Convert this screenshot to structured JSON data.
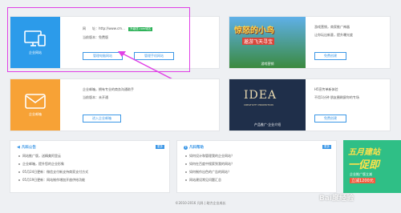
{
  "cards": {
    "website": {
      "tile_label": "企业网站",
      "url_label": "网　　址：http://www.cm...",
      "tag": "升级送.com域名",
      "version_label": "当前版本：免费版",
      "btn_manage_pc": "管理电脑网站",
      "btn_manage_mobile": "管理手机网站"
    },
    "game": {
      "banner_line1": "惊怒的小鸟",
      "banner_line2": "遨游飞天寻宝",
      "banner_caption": "游戏营销",
      "desc_line1": "游戏营销，商家推广神器",
      "desc_line2": "让你玩出新意，提升曝光度",
      "btn": "免费创建"
    },
    "mail": {
      "tile_label": "企业邮箱",
      "desc_line1": "企业邮箱，拥有专业的商务沟通助手",
      "version_label": "当前版本：未开通",
      "btn": "进入企业邮箱"
    },
    "h5": {
      "banner_title": "IDEA",
      "banner_sub": "CREATIVITY PROMOTION",
      "banner_caption": "产品推广·企业介绍",
      "desc_line1": "H5宣传单新体验",
      "desc_line2": "不用1分钟 朋友圈刷屏你的专场",
      "btn": "免费创建"
    }
  },
  "notice": {
    "title": "凡科公告",
    "more": "更多",
    "items": [
      "网站推广版，送精美阿里云",
      "企业邮箱，提升您的企业形象",
      "05月24日更新：微信支付新支持商家支付方式",
      "05月19日更新：网站制作增加开放供给功能"
    ]
  },
  "help": {
    "title": "凡科帮助",
    "more": "更多",
    "items": [
      "如何设计和管理我的企业网站？",
      "如何在百度中搜索到我的网站？",
      "如何制作出色的广告的网站？",
      "网站建设常见问题汇总"
    ]
  },
  "promo": {
    "line1": "五月建站",
    "line2": "一促即",
    "sub": "企业推广版立减",
    "price": "立减1200元"
  },
  "footer": {
    "text": "©2010-2016 凡科 | 助力企业成长"
  },
  "watermark": "Bai度经验"
}
